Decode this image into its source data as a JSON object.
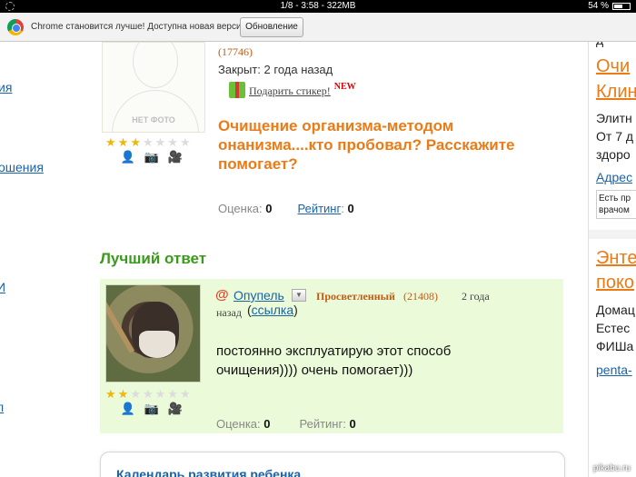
{
  "status_bar": {
    "center": "1/8 - 3:58 - 322MB",
    "battery": "54 %",
    "battery_level": 0.54
  },
  "update_bar": {
    "message": "Chrome становится лучше! Доступна новая версия.",
    "button": "Обновление"
  },
  "left_nav": [
    "ия",
    "ошения",
    "И",
    "л"
  ],
  "question": {
    "rank_count": "(17746)",
    "closed": "Закрыт: 2 года назад",
    "gift_link": "Подарить стикер!",
    "new_badge": "NEW",
    "photo_placeholder": "НЕТ ФОТО",
    "stars_filled": 3,
    "stars_total": 7,
    "title": "Очищение организма-методом онанизма....кто пробовал? Расскажите помогает?",
    "score_label": "Оценка:",
    "score_value": "0",
    "rating_label": "Рейтинг",
    "rating_value": "0"
  },
  "best_answer": {
    "heading": "Лучший ответ",
    "username": "Опупель",
    "rank": "Просветленный",
    "rank_count": "(21408)",
    "time_1": "2 года",
    "time_2": "назад",
    "link_label": "ссылка",
    "stars_filled": 2,
    "stars_total": 7,
    "text": "постоянно эксплуатирую этот способ очищения)))) очень помогает)))",
    "score_label": "Оценка:",
    "score_value": "0",
    "rating_label": "Рейтинг:",
    "rating_value": "0"
  },
  "calendar": {
    "title": "Календарь развития ребенка"
  },
  "right_col": {
    "top_fragment": "д",
    "ad1_title_1": "Очи",
    "ad1_title_2": "Клин",
    "ad1_text_1": "Элитн",
    "ad1_text_2": "От 7 д",
    "ad1_text_3": "здоро",
    "ad1_link": "Адрес",
    "ad1_box_1": "Есть пр",
    "ad1_box_2": "врачом",
    "ad2_title_1": "Энте",
    "ad2_title_2": "поко",
    "ad2_text_1": "Домац",
    "ad2_text_2": "Естес",
    "ad2_text_3": "ФИШа",
    "ad2_link": "penta-"
  },
  "watermark": "pikabu.ru"
}
